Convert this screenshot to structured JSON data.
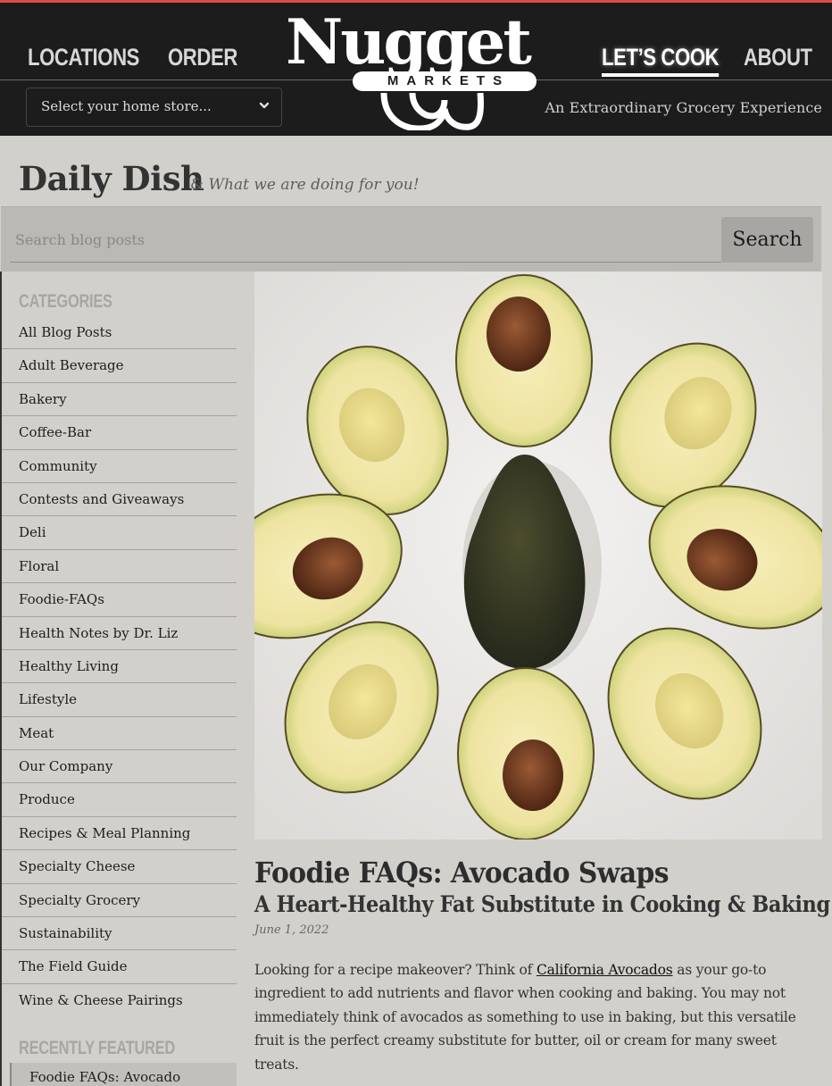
{
  "header": {
    "nav": {
      "locations": "LOCATIONS",
      "order": "ORDER",
      "lets_cook": "LET’S COOK",
      "about": "ABOUT"
    },
    "active_nav": "lets_cook",
    "logo": {
      "wordmark": "Nugget",
      "sub": "MARKETS"
    },
    "store_select": {
      "placeholder": "Select your home store..."
    },
    "tagline": "An Extraordinary Grocery Experience",
    "accent_color": "#e24a46"
  },
  "page": {
    "title": "Daily Dish",
    "subtitle_amp": "&",
    "subtitle": "What we are doing for you!"
  },
  "search": {
    "placeholder": "Search blog posts",
    "value": "",
    "button": "Search"
  },
  "sidebar": {
    "categories_heading": "CATEGORIES",
    "categories": [
      "All Blog Posts",
      "Adult Beverage",
      "Bakery",
      "Coffee-Bar",
      "Community",
      "Contests and Giveaways",
      "Deli",
      "Floral",
      "Foodie-FAQs",
      "Health Notes by Dr. Liz",
      "Healthy Living",
      "Lifestyle",
      "Meat",
      "Our Company",
      "Produce",
      "Recipes & Meal Planning",
      "Specialty Cheese",
      "Specialty Grocery",
      "Sustainability",
      "The Field Guide",
      "Wine & Cheese Pairings"
    ],
    "recent_heading": "RECENTLY FEATURED",
    "recent": [
      "Foodie FAQs: Avocado"
    ]
  },
  "article": {
    "image_alt": "Halved avocados arranged in a circle around a whole avocado",
    "title": "Foodie FAQs: Avocado Swaps",
    "subtitle": "A Heart-Healthy Fat Substitute in Cooking & Baking",
    "date": "June 1, 2022",
    "body_before": "Looking for a recipe makeover? Think of ",
    "body_link": "California Avocados",
    "body_after": " as your go-to ingredient to add nutrients and flavor when cooking and baking. You may not immediately think of avocados as something to use in baking, but this versatile fruit is the perfect creamy substitute for butter, oil or cream for many sweet treats."
  }
}
